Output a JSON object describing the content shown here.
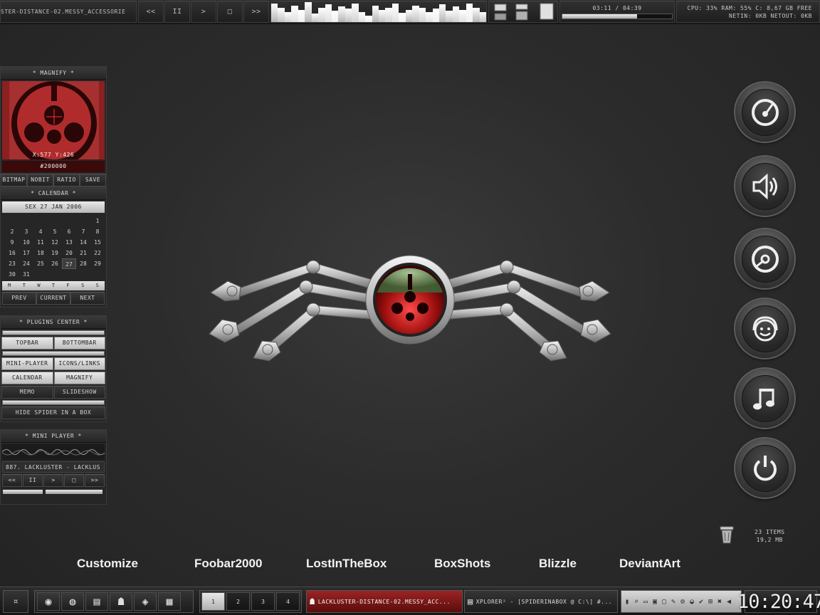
{
  "topbar": {
    "track_title": "STER-DISTANCE-02.MESSY_ACCESSORIE",
    "controls": [
      "<<",
      "II",
      ">",
      "□",
      ">>"
    ],
    "time": "03:11 / 04:39",
    "progress": 0.68,
    "stats_line1": "CPU: 33%  RAM: 55%  C: 8,67 GB FREE",
    "stats_line2": "NETIN: 0KB   NETOUT: 0KB"
  },
  "magnify": {
    "title": "* MAGNIFY *",
    "coords": "X:577  Y:426",
    "hex": "#200000",
    "buttons": [
      "BITMAP",
      "NOBIT",
      "RATIO",
      "SAVE"
    ]
  },
  "calendar": {
    "title": "* CALENDAR *",
    "date": "SEX 27 JAN  2006",
    "days": [
      "",
      "",
      "",
      "",
      "",
      "",
      "1",
      "2",
      "3",
      "4",
      "5",
      "6",
      "7",
      "8",
      "9",
      "10",
      "11",
      "12",
      "13",
      "14",
      "15",
      "16",
      "17",
      "18",
      "19",
      "20",
      "21",
      "22",
      "23",
      "24",
      "25",
      "26",
      "27",
      "28",
      "29",
      "30",
      "31"
    ],
    "today": "27",
    "weekdays": [
      "M",
      "T",
      "W",
      "T",
      "F",
      "S",
      "S"
    ],
    "buttons": [
      "PREV",
      "CURRENT",
      "NEXT"
    ]
  },
  "plugins": {
    "title": "* PLUGINS CENTER *",
    "row1": [
      "TOPBAR",
      "BOTTOMBAR"
    ],
    "row2": [
      "MINI-PLAYER",
      "ICONS/LINKS"
    ],
    "row3": [
      "CALENDAR",
      "MAGNIFY"
    ],
    "row4": [
      "MEMO",
      "SLIDESHOW"
    ],
    "hide_button": "HIDE SPIDER IN A BOX"
  },
  "miniplayer": {
    "title": "* MINI PLAYER *",
    "track": "887. LACKLUSTER - LACKLUS",
    "controls": [
      "<<",
      "II",
      ">",
      "□",
      ">>"
    ]
  },
  "dock": {
    "items": [
      "turntable-icon",
      "speaker-icon",
      "cd-icon",
      "smiley-headphones-icon",
      "music-note-icon",
      "power-icon"
    ]
  },
  "shortcuts": [
    "Customize",
    "Foobar2000",
    "LostInTheBox",
    "BoxShots",
    "Blizzle",
    "DeviantArt"
  ],
  "trash": {
    "items": "23 ITEMS",
    "size": "19,2 MB"
  },
  "taskbar": {
    "start": "¤",
    "pages": [
      "1",
      "2",
      "3",
      "4"
    ],
    "task1": "LACKLUSTER-DISTANCE-02.MESSY_ACC...",
    "task2": "XPLORER² - [SPIDERINABOX @ C:\\] #...",
    "clock": "10:20:47"
  },
  "colors": {
    "accent_red": "#9b2424",
    "background": "#2c2c2c"
  }
}
